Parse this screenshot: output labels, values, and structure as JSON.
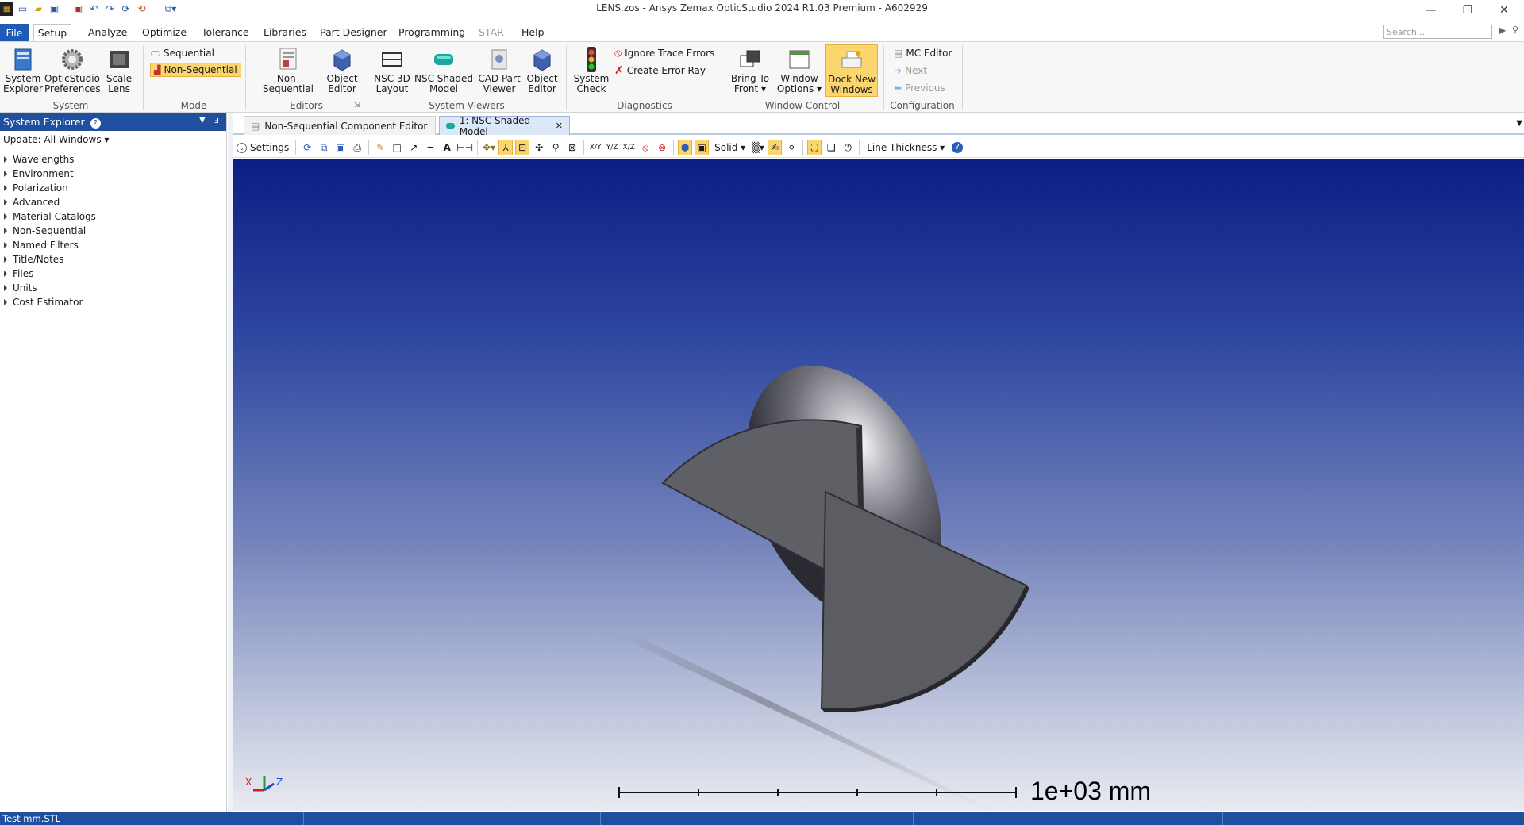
{
  "window": {
    "title": "LENS.zos - Ansys Zemax OpticStudio 2024 R1.03   Premium - A602929",
    "minimize_icon": "minimize-icon",
    "restore_icon": "restore-icon",
    "close_icon": "close-icon"
  },
  "menus": [
    "File",
    "Setup",
    "Analyze",
    "Optimize",
    "Tolerance",
    "Libraries",
    "Part Designer",
    "Programming",
    "STAR",
    "Help"
  ],
  "search": {
    "placeholder": "Search..."
  },
  "ribbon": {
    "system": {
      "label": "System",
      "explorer": "System\nExplorer",
      "prefs": "OpticStudio\nPreferences",
      "scale": "Scale\nLens"
    },
    "mode": {
      "label": "Mode",
      "sequential": "Sequential",
      "nonsequential": "Non-Sequential"
    },
    "editors": {
      "label": "Editors",
      "nonseq": "Non-Sequential",
      "object": "Object\nEditor"
    },
    "viewers": {
      "label": "System Viewers",
      "nsc3d": "NSC 3D\nLayout",
      "nscshaded": "NSC Shaded\nModel",
      "cad": "CAD Part\nViewer",
      "objeditor": "Object\nEditor"
    },
    "diagnostics": {
      "label": "Diagnostics",
      "check": "System\nCheck",
      "ignore": "Ignore Trace Errors",
      "create": "Create Error Ray"
    },
    "windowcontrol": {
      "label": "Window Control",
      "bring": "Bring To\nFront ▾",
      "options": "Window\nOptions ▾",
      "dock": "Dock New\nWindows"
    },
    "configuration": {
      "label": "Configuration",
      "mc": "MC Editor",
      "next": "Next",
      "previous": "Previous"
    }
  },
  "explorer": {
    "title": "System Explorer",
    "update": "Update: All Windows ▾",
    "items": [
      "Wavelengths",
      "Environment",
      "Polarization",
      "Advanced",
      "Material Catalogs",
      "Non-Sequential",
      "Named Filters",
      "Title/Notes",
      "Files",
      "Units",
      "Cost Estimator"
    ]
  },
  "tabs": {
    "tab1": "Non-Sequential Component Editor",
    "tab2": "1: NSC Shaded Model"
  },
  "viewtoolbar": {
    "settings": "Settings",
    "solid": "Solid ▾",
    "linethickness": "Line Thickness ▾",
    "xy": "X/Y",
    "yz": "Y/Z",
    "xz": "X/Z"
  },
  "viewport": {
    "scale_label": "1e+03 mm",
    "axis_x": "X",
    "axis_z": "Z"
  },
  "status": {
    "text": "Test mm.STL"
  },
  "colors": {
    "accent": "#1f5bb5",
    "highlight": "#fbd56e",
    "panel": "#1f4f9e"
  }
}
